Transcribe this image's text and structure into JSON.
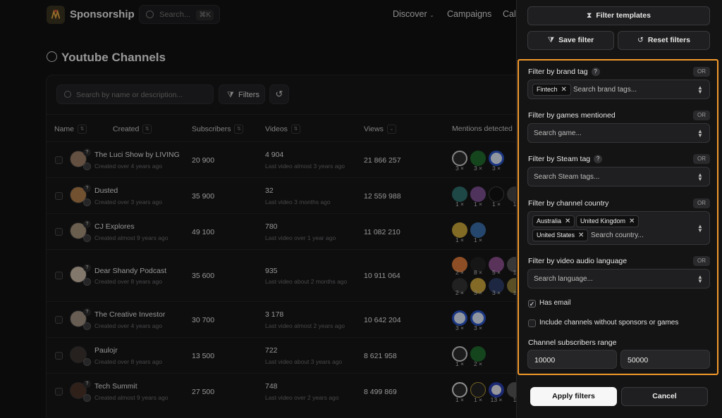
{
  "app": {
    "brand": "Sponsorship"
  },
  "topnav": {
    "search_placeholder": "Search...",
    "search_shortcut": "⌘K",
    "links": [
      "Discover",
      "Campaigns",
      "Cale"
    ]
  },
  "page": {
    "title": "Youtube Channels"
  },
  "table_toolbar": {
    "search_placeholder": "Search by name or description...",
    "filters_label": "Filters"
  },
  "table": {
    "columns": [
      "Name",
      "Created",
      "Subscribers",
      "Videos",
      "Views",
      "Mentions detected"
    ],
    "rows": [
      {
        "name": "The Luci Show by LIVING",
        "created": "Created over 4 years ago",
        "subscribers": "20 900",
        "videos": "4 904",
        "last_video": "Last video almost 3 years ago",
        "views": "21 866 257",
        "mentions": [
          "3 ×",
          "3 ×",
          "3 ×"
        ]
      },
      {
        "name": "Dusted",
        "created": "Created over 3 years ago",
        "subscribers": "35 900",
        "videos": "32",
        "last_video": "Last video 3 months ago",
        "views": "12 559 988",
        "mentions": [
          "1 ×",
          "1 ×",
          "1 ×",
          "1"
        ]
      },
      {
        "name": "CJ Explores",
        "created": "Created almost 9 years ago",
        "subscribers": "49 100",
        "videos": "780",
        "last_video": "Last video over 1 year ago",
        "views": "11 082 210",
        "mentions": [
          "1 ×",
          "1 ×"
        ]
      },
      {
        "name": "Dear Shandy Podcast",
        "created": "Created over 8 years ago",
        "subscribers": "35 600",
        "videos": "935",
        "last_video": "Last video about 2 months ago",
        "views": "10 911 064",
        "mentions": [
          "2 ×",
          "8 ×",
          "5 ×",
          "1",
          "2 ×",
          "3 ×",
          "3 ×",
          "1"
        ]
      },
      {
        "name": "The Creative Investor",
        "created": "Created over 4 years ago",
        "subscribers": "30 700",
        "videos": "3 178",
        "last_video": "Last video almost 2 years ago",
        "views": "10 642 204",
        "mentions": [
          "3 ×",
          "3 ×"
        ]
      },
      {
        "name": "Paulojr",
        "created": "Created over 8 years ago",
        "subscribers": "13 500",
        "videos": "722",
        "last_video": "Last video about 3 years ago",
        "views": "8 621 958",
        "mentions": [
          "1 ×",
          "2 ×"
        ]
      },
      {
        "name": "Tech Summit",
        "created": "Created almost 9 years ago",
        "subscribers": "27 500",
        "videos": "748",
        "last_video": "Last video over 2 years ago",
        "views": "8 499 869",
        "mentions": [
          "1 ×",
          "1 ×",
          "13 ×",
          "1"
        ]
      }
    ]
  },
  "drawer": {
    "filter_templates": "Filter templates",
    "save_filter": "Save filter",
    "reset_filters": "Reset filters",
    "or_badge": "OR",
    "brand_tag": {
      "label": "Filter by brand tag",
      "chips": [
        "Fintech"
      ],
      "placeholder": "Search brand tags..."
    },
    "games": {
      "label": "Filter by games mentioned",
      "placeholder": "Search game..."
    },
    "steam": {
      "label": "Filter by Steam tag",
      "placeholder": "Search Steam tags..."
    },
    "country": {
      "label": "Filter by channel country",
      "chips": [
        "Australia",
        "United Kingdom",
        "United States"
      ],
      "placeholder": "Search country..."
    },
    "language": {
      "label": "Filter by video audio language",
      "placeholder": "Search language..."
    },
    "has_email": {
      "label": "Has email",
      "checked": true
    },
    "include_no_sponsors": {
      "label": "Include channels without sponsors or games",
      "checked": false
    },
    "range": {
      "label": "Channel subscribers range",
      "min": "10000",
      "max": "50000"
    },
    "apply": "Apply filters",
    "cancel": "Cancel"
  }
}
